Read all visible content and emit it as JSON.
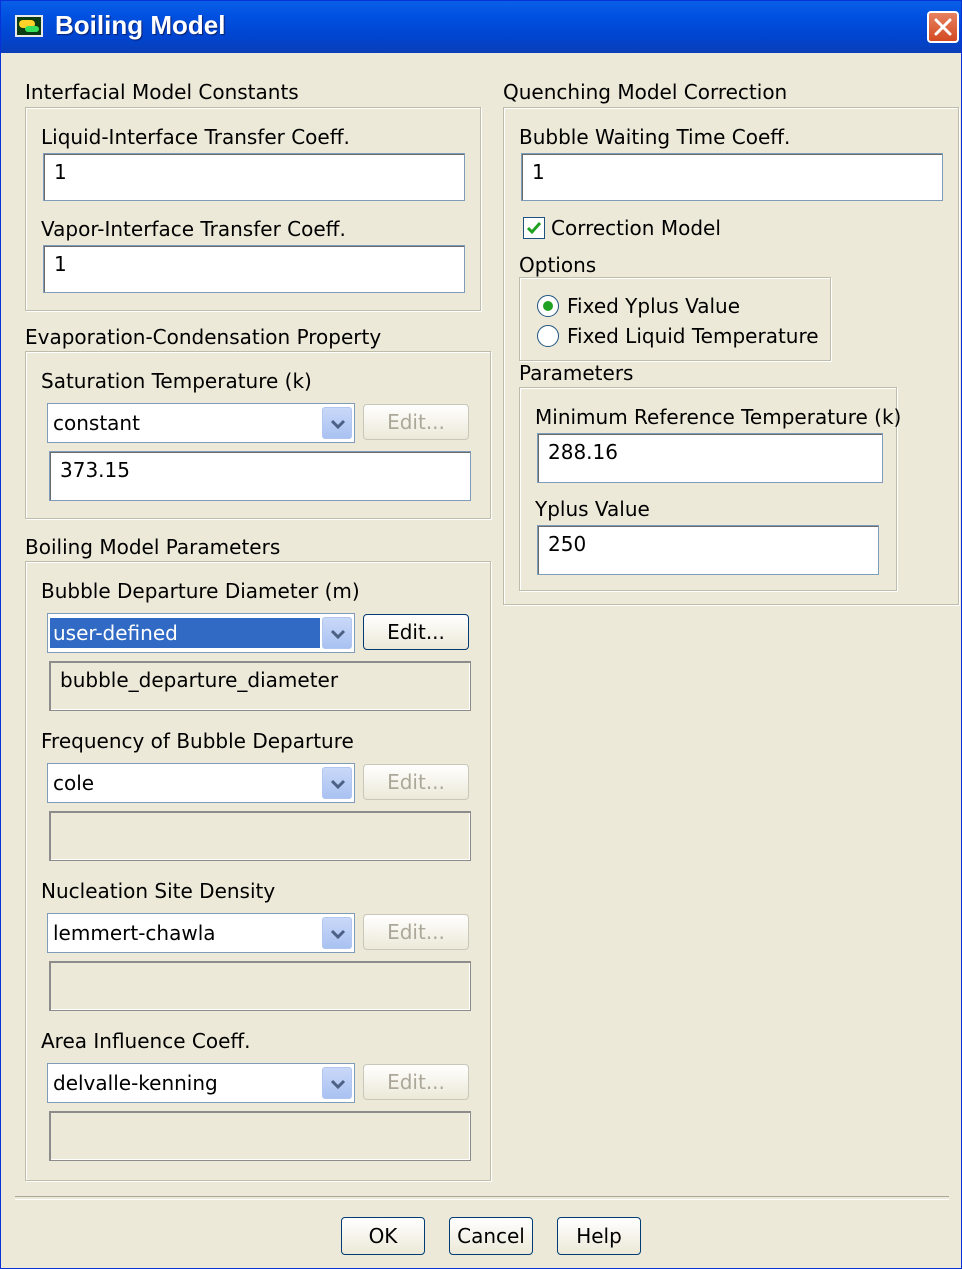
{
  "window": {
    "title": "Boiling Model",
    "close_icon": "close-icon",
    "app_icon": "fluent-app-icon"
  },
  "interfacial": {
    "title": "Interfacial Model Constants",
    "liquid_label": "Liquid-Interface Transfer Coeff.",
    "liquid_value": "1",
    "vapor_label": "Vapor-Interface Transfer Coeff.",
    "vapor_value": "1"
  },
  "evaporation": {
    "title": "Evaporation-Condensation Property",
    "sat_label": "Saturation Temperature (k)",
    "sat_method": "constant",
    "edit_label": "Edit...",
    "sat_value": "373.15"
  },
  "boiling": {
    "title": "Boiling Model Parameters",
    "bubble_diam_label": "Bubble Departure Diameter (m)",
    "bubble_diam_method": "user-defined",
    "bubble_diam_edit": "Edit...",
    "bubble_diam_udf": "bubble_departure_diameter",
    "freq_label": "Frequency of Bubble Departure",
    "freq_method": "cole",
    "freq_edit": "Edit...",
    "freq_value": "",
    "nucleation_label": "Nucleation Site Density",
    "nucleation_method": "lemmert-chawla",
    "nucleation_edit": "Edit...",
    "nucleation_value": "",
    "area_label": "Area Influence Coeff.",
    "area_method": "delvalle-kenning",
    "area_edit": "Edit...",
    "area_value": ""
  },
  "quenching": {
    "title": "Quenching Model Correction",
    "wait_label": "Bubble Waiting Time Coeff.",
    "wait_value": "1",
    "correction_label": "Correction Model",
    "correction_checked": true,
    "options_title": "Options",
    "opt_yplus": "Fixed Yplus Value",
    "opt_liquid": "Fixed Liquid Temperature",
    "selected_option": "Fixed Yplus Value",
    "params_title": "Parameters",
    "min_ref_label": "Minimum Reference Temperature (k)",
    "min_ref_value": "288.16",
    "yplus_label": "Yplus Value",
    "yplus_value": "250"
  },
  "footer": {
    "ok": "OK",
    "cancel": "Cancel",
    "help": "Help"
  },
  "colors": {
    "title_bar": "#0050e0",
    "dialog_bg": "#ece9d8",
    "selection": "#316ac5",
    "close_button": "#d34a22"
  }
}
